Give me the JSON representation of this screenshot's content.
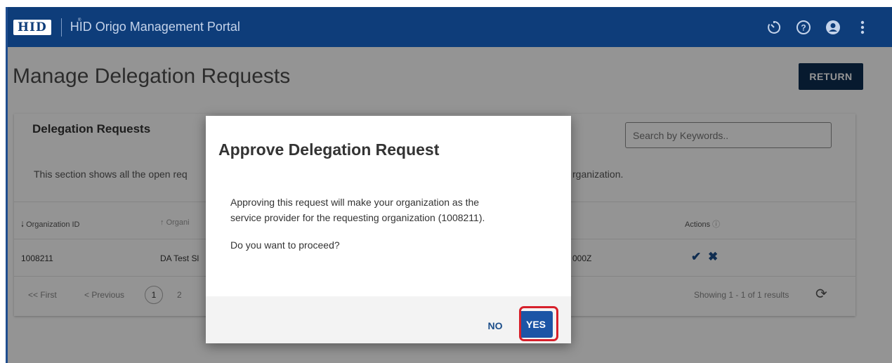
{
  "header": {
    "logo_text": "HID",
    "logo_tm": "®",
    "portal_title": "HID Origo Management Portal",
    "icons": [
      "timer-icon",
      "help-icon",
      "account-icon",
      "more-vertical-icon"
    ]
  },
  "page": {
    "title": "Manage Delegation Requests",
    "return_label": "RETURN"
  },
  "card": {
    "title": "Delegation Requests",
    "search_placeholder": "Search by Keywords..",
    "description": "This section shows all the open req",
    "description_tail": "rganization.",
    "columns": [
      "Organization ID",
      "Organi",
      "Actions"
    ],
    "row": {
      "org_id": "1008211",
      "org_name": "DA Test Sl",
      "date": "000Z"
    },
    "pager": {
      "first": "<< First",
      "previous": "< Previous",
      "current_page": "1",
      "next_page": "2"
    },
    "results": "Showing 1 - 1 of 1 results"
  },
  "modal": {
    "title": "Approve Delegation Request",
    "body_line1": "Approving this request will make your organization as the",
    "body_line2": "service provider for the requesting organization (1008211).",
    "question": "Do you want to proceed?",
    "no_label": "NO",
    "yes_label": "YES"
  },
  "colors": {
    "header_bg": "#0e3d7a",
    "return_bg": "#0d2d52",
    "yes_bg": "#1c55a6",
    "highlight": "#d7202b"
  }
}
